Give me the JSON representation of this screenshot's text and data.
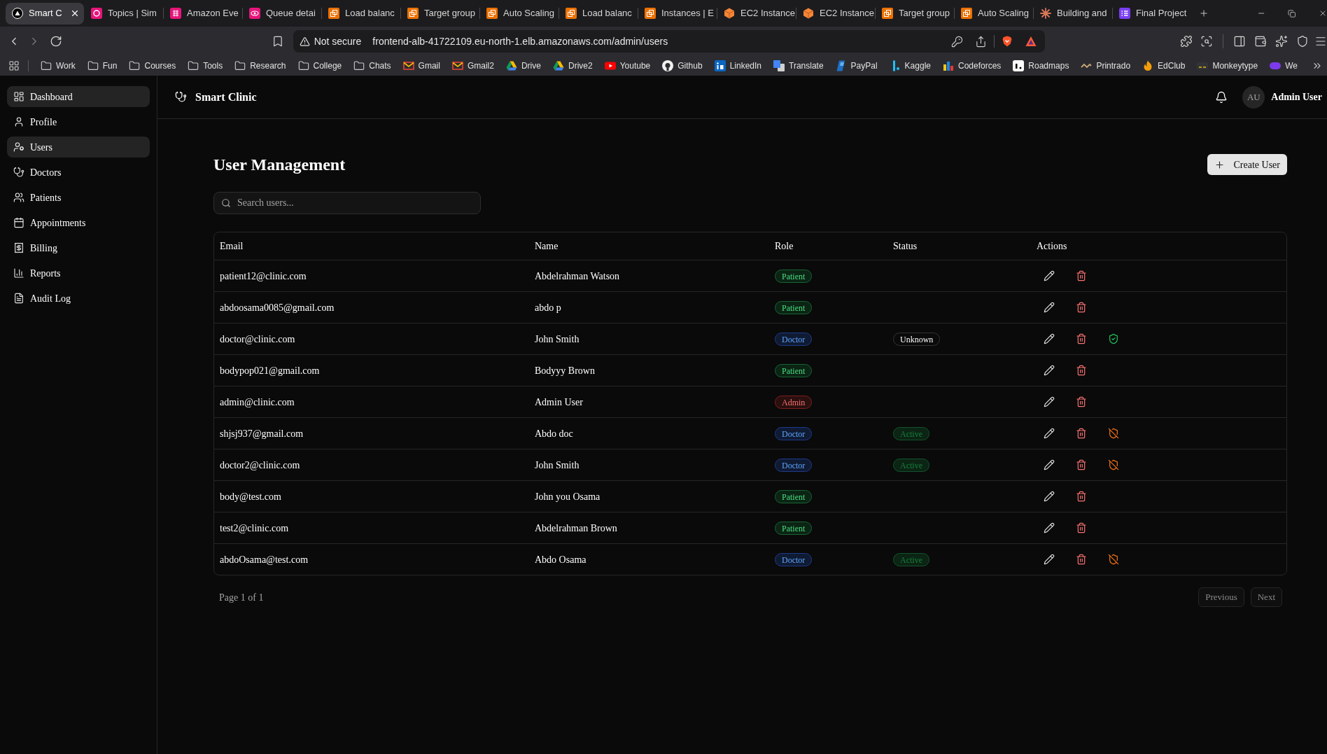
{
  "browser": {
    "tabs": [
      {
        "title": "Smart C",
        "selected": true
      },
      {
        "title": "Topics | Sim",
        "selected": false
      },
      {
        "title": "Amazon Eve",
        "selected": false
      },
      {
        "title": "Queue detai",
        "selected": false
      },
      {
        "title": "Load balanc",
        "selected": false
      },
      {
        "title": "Target group",
        "selected": false
      },
      {
        "title": "Auto Scaling",
        "selected": false
      },
      {
        "title": "Load balanc",
        "selected": false
      },
      {
        "title": "Instances | E",
        "selected": false
      },
      {
        "title": "EC2 Instance",
        "selected": false
      },
      {
        "title": "EC2 Instance",
        "selected": false
      },
      {
        "title": "Target group",
        "selected": false
      },
      {
        "title": "Auto Scaling",
        "selected": false
      },
      {
        "title": "Building and",
        "selected": false
      },
      {
        "title": "Final Project",
        "selected": false
      }
    ],
    "address_bar": {
      "security": "Not secure",
      "url": "frontend-alb-41722109.eu-north-1.elb.amazonaws.com/admin/users"
    },
    "bookmarks": [
      {
        "label": "Work"
      },
      {
        "label": "Fun"
      },
      {
        "label": "Courses"
      },
      {
        "label": "Tools"
      },
      {
        "label": "Research"
      },
      {
        "label": "College"
      },
      {
        "label": "Chats"
      },
      {
        "label": "Gmail"
      },
      {
        "label": "Gmail2"
      },
      {
        "label": "Drive"
      },
      {
        "label": "Drive2"
      },
      {
        "label": "Youtube"
      },
      {
        "label": "Github"
      },
      {
        "label": "LinkedIn"
      },
      {
        "label": "Translate"
      },
      {
        "label": "PayPal"
      },
      {
        "label": "Kaggle"
      },
      {
        "label": "Codeforces"
      },
      {
        "label": "Roadmaps"
      },
      {
        "label": "Printrado"
      },
      {
        "label": "EdClub"
      },
      {
        "label": "Monkeytype"
      },
      {
        "label": "We"
      }
    ]
  },
  "sidebar": {
    "items": [
      {
        "label": "Dashboard",
        "selected": true
      },
      {
        "label": "Profile",
        "selected": false
      },
      {
        "label": "Users",
        "selected": true
      },
      {
        "label": "Doctors",
        "selected": false
      },
      {
        "label": "Patients",
        "selected": false
      },
      {
        "label": "Appointments",
        "selected": false
      },
      {
        "label": "Billing",
        "selected": false
      },
      {
        "label": "Reports",
        "selected": false
      },
      {
        "label": "Audit Log",
        "selected": false
      }
    ]
  },
  "header": {
    "app_name": "Smart Clinic",
    "user": {
      "initials": "AU",
      "name": "Admin User"
    }
  },
  "page": {
    "title": "User Management",
    "create_button": "Create User",
    "search": {
      "placeholder": "Search users..."
    }
  },
  "table": {
    "columns": [
      "Email",
      "Name",
      "Role",
      "Status",
      "Actions"
    ],
    "rows": [
      {
        "email": "patient12@clinic.com",
        "name": "Abdelrahman Watson",
        "role": {
          "label": "Patient",
          "kind": "patient"
        }
      },
      {
        "email": "abdoosama0085@gmail.com",
        "name": "abdo p",
        "role": {
          "label": "Patient",
          "kind": "patient"
        }
      },
      {
        "email": "doctor@clinic.com",
        "name": "John Smith",
        "role": {
          "label": "Doctor",
          "kind": "doctor"
        },
        "status": {
          "label": "Unknown",
          "kind": "unknown"
        }
      },
      {
        "email": "bodypop021@gmail.com",
        "name": "Bodyyy Brown",
        "role": {
          "label": "Patient",
          "kind": "patient"
        }
      },
      {
        "email": "admin@clinic.com",
        "name": "Admin User",
        "role": {
          "label": "Admin",
          "kind": "admin"
        }
      },
      {
        "email": "shjsj937@gmail.com",
        "name": "Abdo doc",
        "role": {
          "label": "Doctor",
          "kind": "doctor"
        },
        "status": {
          "label": "Active",
          "kind": "active"
        }
      },
      {
        "email": "doctor2@clinic.com",
        "name": "John Smith",
        "role": {
          "label": "Doctor",
          "kind": "doctor"
        },
        "status": {
          "label": "Active",
          "kind": "active"
        }
      },
      {
        "email": "body@test.com",
        "name": "John you Osama",
        "role": {
          "label": "Patient",
          "kind": "patient"
        }
      },
      {
        "email": "test2@clinic.com",
        "name": "Abdelrahman Brown",
        "role": {
          "label": "Patient",
          "kind": "patient"
        }
      },
      {
        "email": "abdoOsama@test.com",
        "name": "Abdo Osama",
        "role": {
          "label": "Doctor",
          "kind": "doctor"
        },
        "status": {
          "label": "Active",
          "kind": "active"
        }
      }
    ]
  },
  "pagination": {
    "label": "Page 1 of 1",
    "buttons": [
      {
        "label": "Previous",
        "disabled": true
      },
      {
        "label": "Next",
        "disabled": true
      }
    ]
  }
}
